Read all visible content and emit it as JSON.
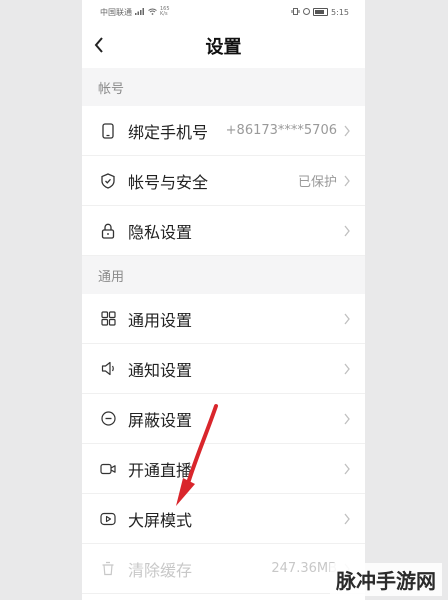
{
  "status": {
    "carrier": "中国联通",
    "net_top": "165",
    "net_bottom": "K/s",
    "time": "5:15"
  },
  "header": {
    "back_icon": "chevron-left-icon",
    "title": "设置"
  },
  "sections": [
    {
      "title": "帐号",
      "items": [
        {
          "icon": "phone-icon",
          "label": "绑定手机号",
          "value": "+86173****5706"
        },
        {
          "icon": "shield-icon",
          "label": "帐号与安全",
          "value": "已保护"
        },
        {
          "icon": "lock-icon",
          "label": "隐私设置",
          "value": ""
        }
      ]
    },
    {
      "title": "通用",
      "items": [
        {
          "icon": "grid-icon",
          "label": "通用设置",
          "value": ""
        },
        {
          "icon": "speaker-icon",
          "label": "通知设置",
          "value": ""
        },
        {
          "icon": "minus-circle-icon",
          "label": "屏蔽设置",
          "value": ""
        },
        {
          "icon": "video-camera-icon",
          "label": "开通直播",
          "value": ""
        },
        {
          "icon": "play-screen-icon",
          "label": "大屏模式",
          "value": ""
        },
        {
          "icon": "trash-icon",
          "label": "清除缓存",
          "value": "247.36MB"
        }
      ]
    }
  ],
  "watermark": "脉冲手游网",
  "colors": {
    "arrow": "#d9262c",
    "background": "#e9e9ea"
  }
}
